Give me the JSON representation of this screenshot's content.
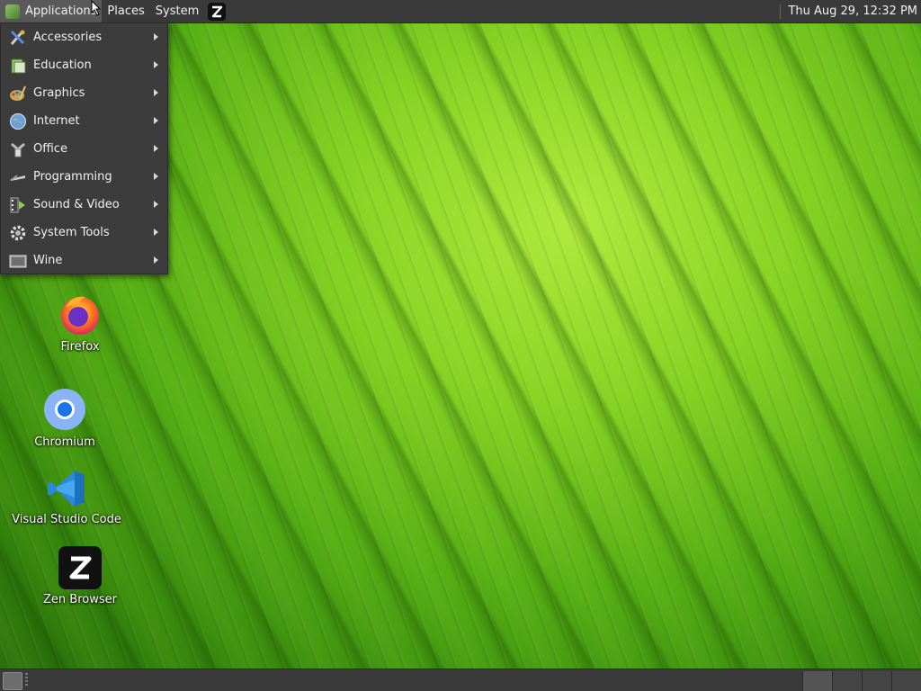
{
  "top_panel": {
    "applications_label": "Applications",
    "places_label": "Places",
    "system_label": "System",
    "clock": "Thu Aug 29, 12:32 PM"
  },
  "app_menu": {
    "items": [
      {
        "label": "Accessories",
        "icon": "accessories-icon"
      },
      {
        "label": "Education",
        "icon": "education-icon"
      },
      {
        "label": "Graphics",
        "icon": "graphics-icon"
      },
      {
        "label": "Internet",
        "icon": "internet-icon"
      },
      {
        "label": "Office",
        "icon": "office-icon"
      },
      {
        "label": "Programming",
        "icon": "programming-icon"
      },
      {
        "label": "Sound & Video",
        "icon": "sound-video-icon"
      },
      {
        "label": "System Tools",
        "icon": "system-tools-icon"
      },
      {
        "label": "Wine",
        "icon": "wine-icon"
      }
    ]
  },
  "desktop": {
    "icons": [
      {
        "label": "Firefox",
        "icon": "firefox-icon"
      },
      {
        "label": "Chromium",
        "icon": "chromium-icon"
      },
      {
        "label": "Visual Studio Code",
        "icon": "vscode-icon"
      },
      {
        "label": "Zen Browser",
        "icon": "zen-browser-icon"
      }
    ]
  },
  "colors": {
    "panel_bg": "#3a3a3a",
    "menu_bg": "#3c3c3c",
    "wallpaper_green": "#6cc21c"
  }
}
